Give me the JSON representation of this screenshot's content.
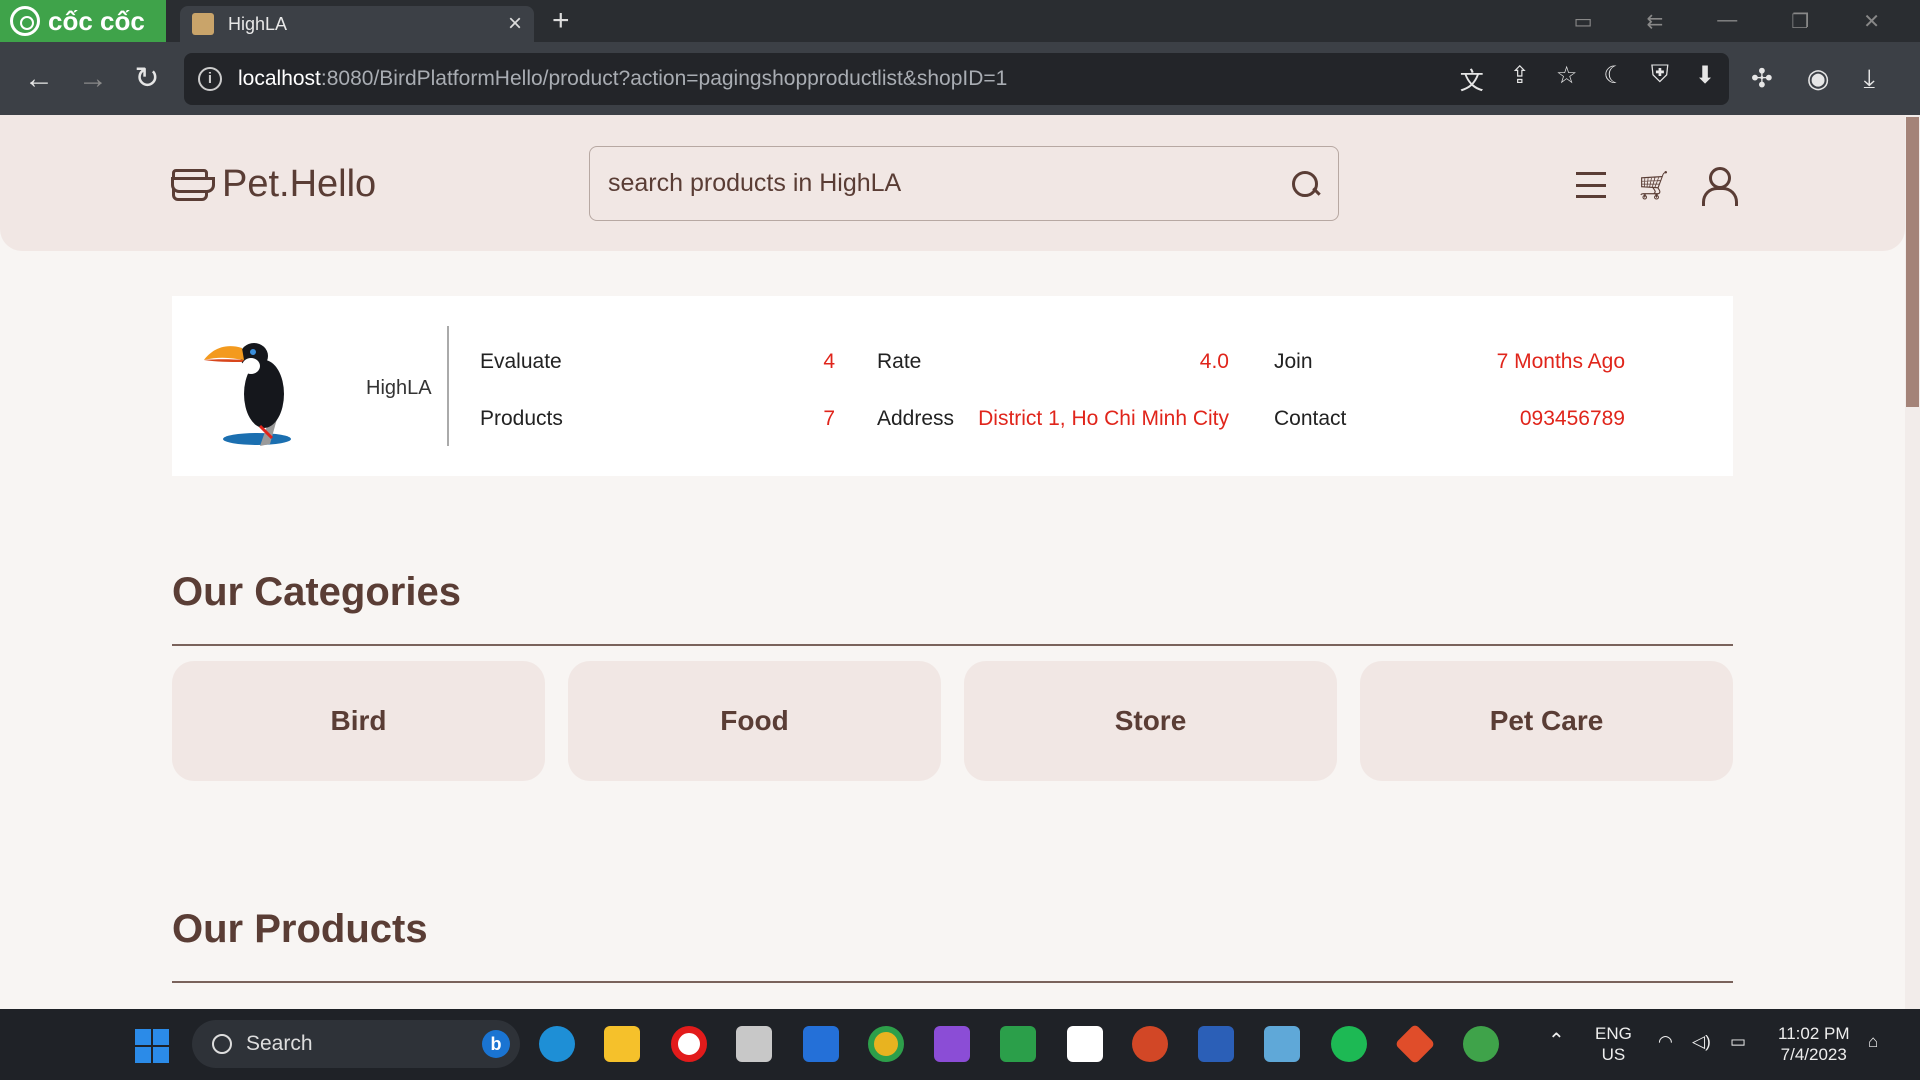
{
  "browser": {
    "brand": "cốc cốc",
    "tab_title": "HighLA",
    "url_host": "localhost",
    "url_rest": ":8080/BirdPlatformHello/product?action=pagingshopproductlist&shopID=1"
  },
  "header": {
    "logo_text": "Pet.Hello",
    "search_placeholder": "search products in HighLA"
  },
  "shop": {
    "name": "HighLA",
    "stats": [
      {
        "label": "Evaluate",
        "value": "4"
      },
      {
        "label": "Products",
        "value": "7"
      },
      {
        "label": "Rate",
        "value": "4.0"
      },
      {
        "label": "Address",
        "value": "District 1, Ho Chi Minh City"
      },
      {
        "label": "Join",
        "value": "7 Months Ago"
      },
      {
        "label": "Contact",
        "value": "093456789"
      }
    ],
    "accent_color": "#e0251b"
  },
  "categories": {
    "title": "Our Categories",
    "items": [
      "Bird",
      "Food",
      "Store",
      "Pet Care"
    ]
  },
  "products": {
    "title": "Our Products"
  },
  "taskbar": {
    "search_label": "Search",
    "lang_top": "ENG",
    "lang_bottom": "US",
    "time": "11:02 PM",
    "date": "7/4/2023"
  },
  "colors": {
    "brand_brown": "#5a3d35",
    "header_bg": "#f1e7e4"
  }
}
